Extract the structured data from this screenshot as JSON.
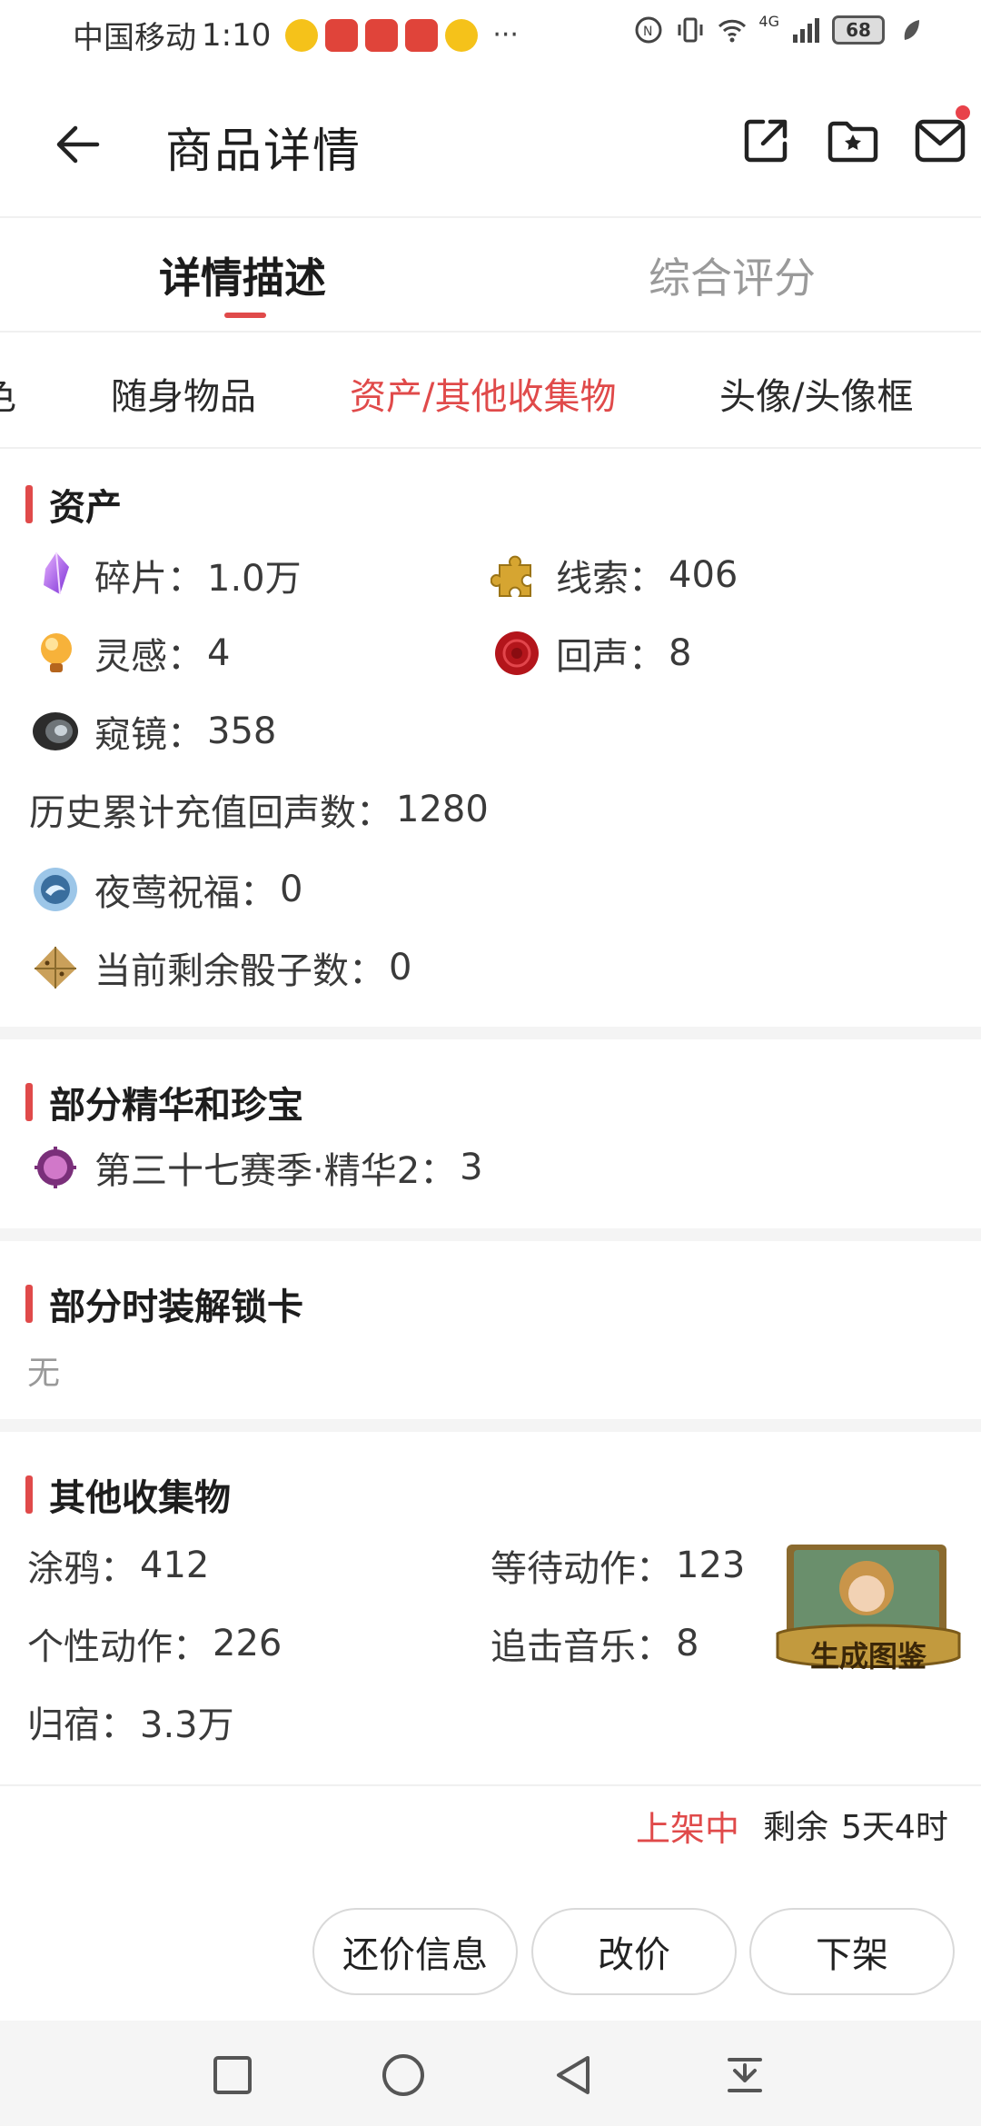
{
  "status_bar": {
    "carrier": "中国移动",
    "time": "1:10",
    "more": "···",
    "network": "4G",
    "battery": "68"
  },
  "header": {
    "title": "商品详情"
  },
  "main_tabs": [
    {
      "label": "详情描述",
      "active": true
    },
    {
      "label": "综合评分",
      "active": false
    }
  ],
  "sub_tabs": [
    {
      "label": "色",
      "active": false
    },
    {
      "label": "随身物品",
      "active": false
    },
    {
      "label": "资产/其他收集物",
      "active": true
    },
    {
      "label": "头像/头像框",
      "active": false
    }
  ],
  "assets": {
    "title": "资产",
    "items": [
      {
        "label": "碎片：",
        "value": "1.0万",
        "icon": "shard-icon"
      },
      {
        "label": "线索：",
        "value": "406",
        "icon": "puzzle-clue-icon"
      },
      {
        "label": "灵感：",
        "value": "4",
        "icon": "lightbulb-inspiration-icon"
      },
      {
        "label": "回声：",
        "value": "8",
        "icon": "wax-seal-echo-icon"
      },
      {
        "label": "窥镜：",
        "value": "358",
        "icon": "lens-icon"
      },
      {
        "label": "历史累计充值回声数：",
        "value": "1280",
        "icon": ""
      },
      {
        "label": "夜莺祝福：",
        "value": "0",
        "icon": "nightingale-blessing-icon"
      },
      {
        "label": "当前剩余骰子数：",
        "value": "0",
        "icon": "dice-icon"
      }
    ]
  },
  "essence": {
    "title": "部分精华和珍宝",
    "items": [
      {
        "label": "第三十七赛季·精华2：",
        "value": "3",
        "icon": "essence-icon"
      }
    ]
  },
  "costume_cards": {
    "title": "部分时装解锁卡",
    "empty_text": "无"
  },
  "other_collectibles": {
    "title": "其他收集物",
    "items": [
      {
        "label": "涂鸦：",
        "value": "412"
      },
      {
        "label": "等待动作：",
        "value": "123"
      },
      {
        "label": "个性动作：",
        "value": "226"
      },
      {
        "label": "追击音乐：",
        "value": "8"
      },
      {
        "label": "归宿：",
        "value": "3.3万"
      }
    ],
    "illustration_label": "生成图鉴"
  },
  "listing": {
    "status": "上架中",
    "remaining_label": "剩余",
    "remaining_value": "5天4时"
  },
  "actions": {
    "counter_offer": "还价信息",
    "change_price": "改价",
    "delist": "下架"
  },
  "colors": {
    "accent": "#e04a4a",
    "text_primary": "#1d1d1d",
    "text_muted": "#999999",
    "separator": "#f4f4f4"
  }
}
